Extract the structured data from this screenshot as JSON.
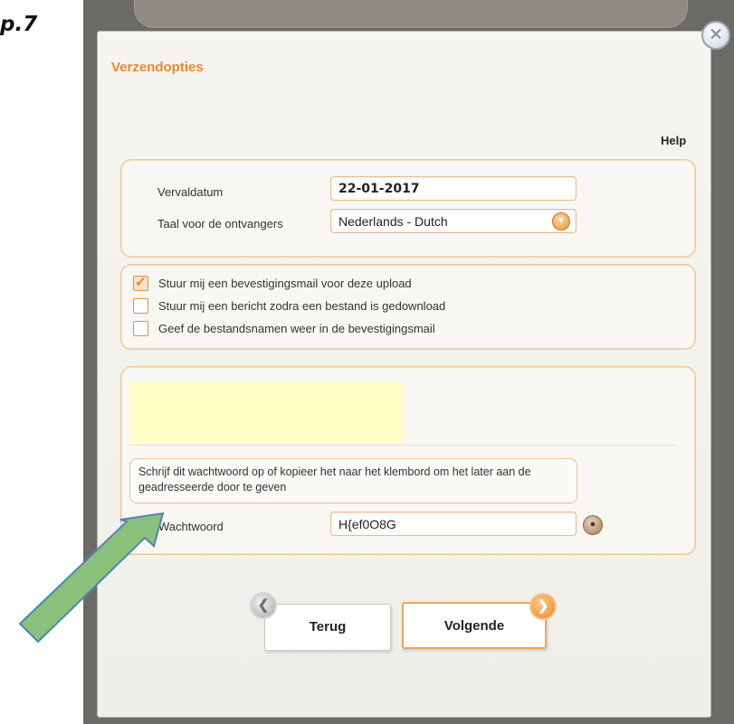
{
  "annotation": {
    "step_label": "p.7",
    "arrow_color": "#8ac17a"
  },
  "dialog": {
    "title": "Verzendopties",
    "help_link": "Help",
    "close_icon": "close-icon",
    "accent_color": "#e88a2a"
  },
  "options": {
    "expiry_label": "Vervaldatum",
    "expiry_value": "22-01-2017",
    "language_label": "Taal voor de ontvangers",
    "language_value": "Nederlands - Dutch",
    "language_dropdown_icon": "chevron-down-icon"
  },
  "notifications": [
    {
      "label": "Stuur mij een bevestigingsmail voor deze upload",
      "checked": true
    },
    {
      "label": "Stuur mij een bericht zodra een bestand is gedownload",
      "checked": false
    },
    {
      "label": "Geef de bestandsnamen weer in de bevestigingsmail",
      "checked": false
    }
  ],
  "password": {
    "note": "Schrijf dit wachtwoord op of kopieer het naar het klembord om het later aan de geadresseerde door te geven",
    "label": "Wachtwoord",
    "value": "H{ef0O8G",
    "icon": "lock-icon"
  },
  "navigation": {
    "back_label": "Terug",
    "next_label": "Volgende"
  }
}
